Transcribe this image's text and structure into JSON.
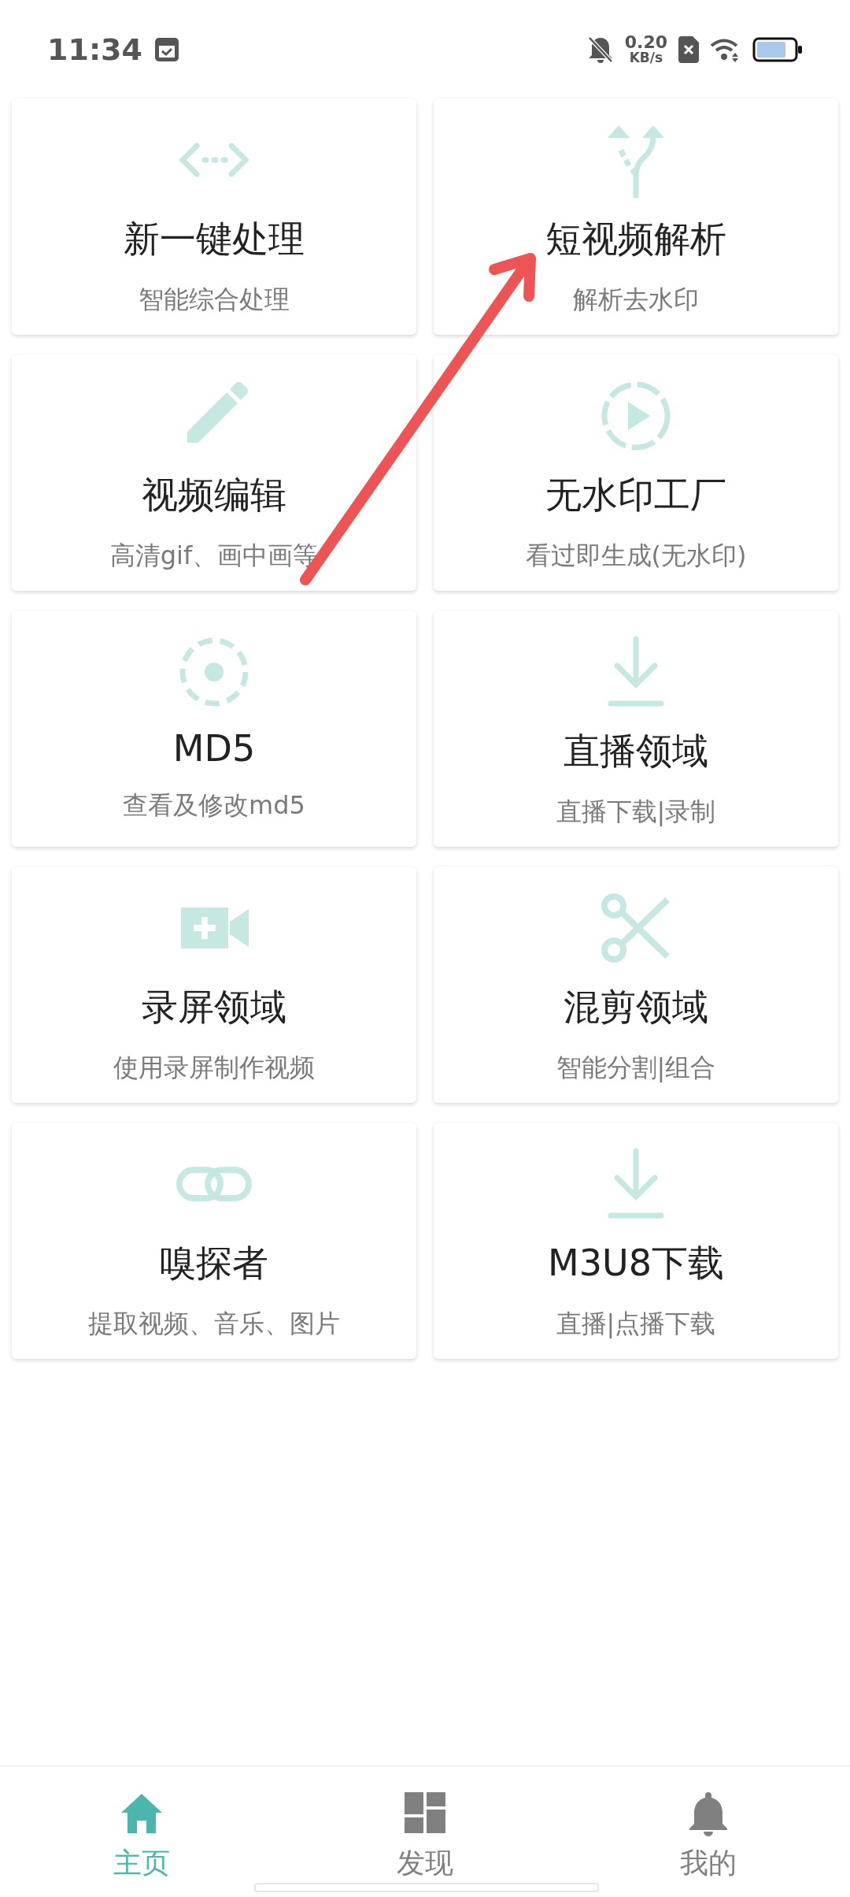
{
  "status_bar": {
    "time": "11:34",
    "speed_value": "0.20",
    "speed_unit": "KB/s"
  },
  "tiles": [
    {
      "kind": "code",
      "title": "新一键处理",
      "subtitle": "智能综合处理"
    },
    {
      "kind": "fork",
      "title": "短视频解析",
      "subtitle": "解析去水印"
    },
    {
      "kind": "pencil",
      "title": "视频编辑",
      "subtitle": "高清gif、画中画等"
    },
    {
      "kind": "play",
      "title": "无水印工厂",
      "subtitle": "看过即生成(无水印)"
    },
    {
      "kind": "target",
      "title": "MD5",
      "subtitle": "查看及修改md5"
    },
    {
      "kind": "download",
      "title": "直播领域",
      "subtitle": "直播下载|录制"
    },
    {
      "kind": "camera",
      "title": "录屏领域",
      "subtitle": "使用录屏制作视频"
    },
    {
      "kind": "scissors",
      "title": "混剪领域",
      "subtitle": "智能分割|组合"
    },
    {
      "kind": "link",
      "title": "嗅探者",
      "subtitle": "提取视频、音乐、图片"
    },
    {
      "kind": "download",
      "title": "M3U8下载",
      "subtitle": "直播|点播下载"
    }
  ],
  "bottom_nav": [
    {
      "kind": "home",
      "label": "主页",
      "selected": true
    },
    {
      "kind": "grid",
      "label": "发现",
      "selected": false
    },
    {
      "kind": "bell",
      "label": "我的",
      "selected": false
    }
  ]
}
